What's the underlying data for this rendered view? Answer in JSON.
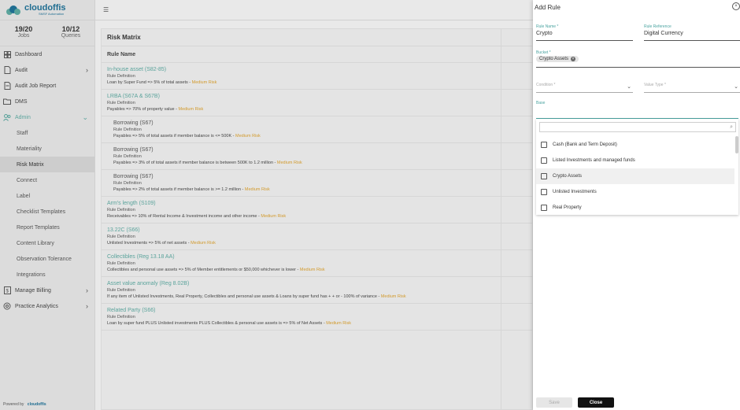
{
  "brand": {
    "name": "cloudoffis",
    "tagline": "SMSF Automation",
    "powered_by": "Powered by",
    "powered_brand": "cloudoffis"
  },
  "stats": [
    {
      "num": "19/20",
      "label": "Jobs"
    },
    {
      "num": "10/12",
      "label": "Queries"
    }
  ],
  "nav": {
    "dashboard": "Dashboard",
    "audit": "Audit",
    "audit_job_report": "Audit Job Report",
    "dms": "DMS",
    "admin": "Admin",
    "admin_sub": [
      "Staff",
      "Materiality",
      "Risk Matrix",
      "Connect",
      "Label",
      "Checklist Templates",
      "Report Templates",
      "Content Library",
      "Observation Tolerance",
      "Integrations"
    ],
    "manage_billing": "Manage Billing",
    "practice_analytics": "Practice Analytics"
  },
  "topbar": {
    "menu_icon": "menu-collapse-icon"
  },
  "main": {
    "title": "Risk Matrix",
    "column": "Rule Name",
    "rows": [
      {
        "name": "In-house asset (S82-85)",
        "def": "Rule Definition",
        "desc": "Loan by Super Fund => 5% of total assets - ",
        "risk": "Medium Risk",
        "sub": false
      },
      {
        "name": "LRBA (S67A & S67B)",
        "def": "Rule Definition",
        "desc": "Payables => 70% of property value - ",
        "risk": "Medium Risk",
        "sub": false
      },
      {
        "name": "Borrowing (S67)",
        "def": "Rule Definition",
        "desc": "Payables => 5% of total assets if member balance is <= 500K - ",
        "risk": "Medium Risk",
        "sub": true
      },
      {
        "name": "Borrowing (S67)",
        "def": "Rule Definition",
        "desc": "Payables => 3% of of total assets if member balance is between 500K to 1.2 million - ",
        "risk": "Medium Risk",
        "sub": true
      },
      {
        "name": "Borrowing (S67)",
        "def": "Rule Definition",
        "desc": "Payables => 2% of total assets if member balance is >= 1.2 million - ",
        "risk": "Medium Risk",
        "sub": true
      },
      {
        "name": "Arm's length (S109)",
        "def": "Rule Definition",
        "desc": "Receivables => 10% of Rental Income & Investment income and other income - ",
        "risk": "Medium Risk",
        "sub": false
      },
      {
        "name": "13.22C (S66)",
        "def": "Rule Definition",
        "desc": "Unlisted Investments => 5% of net assets - ",
        "risk": "Medium Risk",
        "sub": false
      },
      {
        "name": "Collectibles (Reg 13.18 AA)",
        "def": "Rule Definition",
        "desc": "Collectibles and personal use assets => 5% of Member entitlements or $50,000 whichever is lower - ",
        "risk": "Medium Risk",
        "sub": false
      },
      {
        "name": "Asset value anomaly (Reg 8.02B)",
        "def": "Rule Definition",
        "desc": "If any item of Unlisted Investments, Real Property, Collectibles and personal use assets & Loans by super fund has + + or - 100% of variance - ",
        "risk": "Medium Risk",
        "sub": false
      },
      {
        "name": "Related Party (S66)",
        "def": "Rule Definition",
        "desc": "Loan by super fund PLUS Unlisted investments PLUS Collectibles & personal use assets is => 5% of Net Assets - ",
        "risk": "Medium Risk",
        "sub": false
      }
    ]
  },
  "panel": {
    "title": "Add Rule",
    "rule_name_label": "Rule Name *",
    "rule_name_value": "Crypto",
    "rule_ref_label": "Rule Reference",
    "rule_ref_value": "Digital Currency",
    "bucket_label": "Bucket *",
    "bucket_chip": "Crypto Assets",
    "condition_label": "Condition *",
    "value_type_label": "Value Type *",
    "base_label": "Base",
    "options": [
      "Cash (Bank and Term Deposit)",
      "Listed Investments and managed funds",
      "Crypto Assets",
      "Unlisted Investments",
      "Real Property"
    ],
    "save": "Save",
    "close": "Close"
  }
}
